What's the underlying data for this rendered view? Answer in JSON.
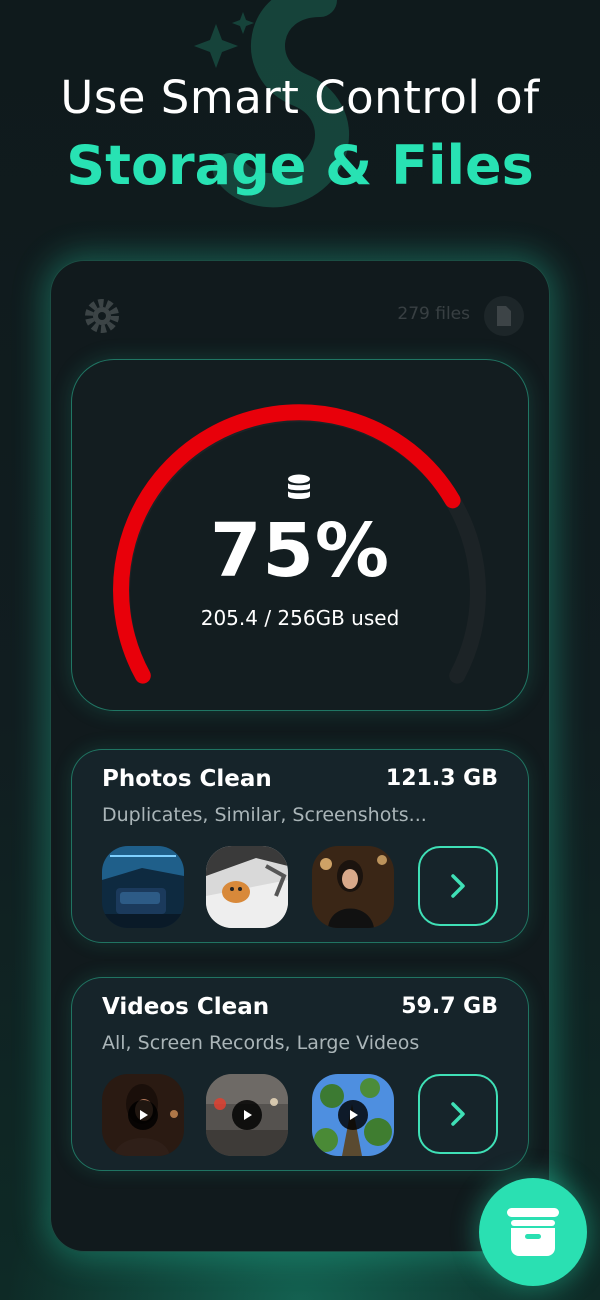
{
  "headline": {
    "line1": "Use Smart Control of",
    "line2": "Storage & Files"
  },
  "colors": {
    "accent": "#28e2b3",
    "gauge_used": "#e8000a",
    "gauge_track": "#1c2326",
    "background": "#111a1d"
  },
  "topbar": {
    "settings_icon": "gear-icon",
    "files_count": "279 files",
    "files_icon": "document-icon"
  },
  "storage": {
    "icon": "database-icon",
    "percent_label": "75%",
    "percent_value": 75,
    "used_label": "205.4 / 256GB used"
  },
  "photos": {
    "title": "Photos Clean",
    "size": "121.3 GB",
    "subtitle": "Duplicates, Similar, Screenshots...",
    "thumbnails": [
      "bedroom-photo",
      "cat-in-car-photo",
      "woman-portrait-photo"
    ],
    "button_icon": "chevron-right-icon"
  },
  "videos": {
    "title": "Videos Clean",
    "size": "59.7 GB",
    "subtitle": "All, Screen Records, Large Videos",
    "thumbnails": [
      "woman-video",
      "night-street-video",
      "tree-sky-video"
    ],
    "button_icon": "chevron-right-icon"
  },
  "fab": {
    "icon": "archive-box-icon"
  }
}
